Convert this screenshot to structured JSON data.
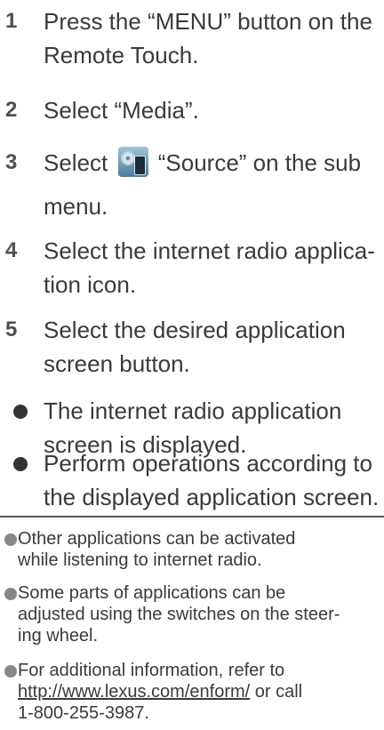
{
  "steps": [
    {
      "num": "1",
      "lines": [
        "Press the “MENU” button on the",
        "Remote Touch."
      ]
    },
    {
      "num": "2",
      "lines": [
        "Select “Media”."
      ]
    },
    {
      "num": "3",
      "before_icon": "Select",
      "after_icon": "“Source” on the sub",
      "line2": "menu.",
      "icon": "source-icon"
    },
    {
      "num": "4",
      "lines": [
        "Select the internet radio applica-",
        "tion icon."
      ]
    },
    {
      "num": "5",
      "lines": [
        "Select the desired application",
        "screen button."
      ]
    }
  ],
  "bullets": [
    {
      "lines": [
        "The internet radio application",
        "screen is displayed."
      ]
    },
    {
      "lines": [
        "Perform operations according to",
        "the displayed application screen."
      ]
    }
  ],
  "notes": [
    {
      "lines": [
        "Other applications can be activated",
        "while listening to internet radio."
      ]
    },
    {
      "lines": [
        "Some parts of applications can be",
        "adjusted using the switches on the steer-",
        "ing wheel."
      ]
    },
    {
      "prefix": "For additional information, refer to",
      "link": "http://www.lexus.com/enform/",
      "link_suffix": " or call",
      "phone": "1-800-255-3987."
    }
  ]
}
